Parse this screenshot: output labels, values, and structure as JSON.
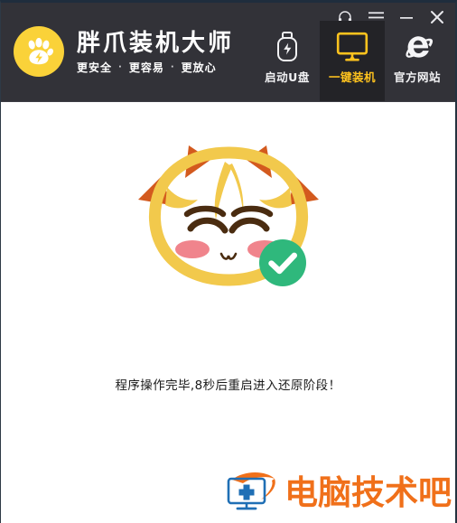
{
  "window": {
    "controls": [
      {
        "name": "support-headset",
        "label": "客服"
      },
      {
        "name": "menu",
        "label": "菜单"
      },
      {
        "name": "minimize",
        "label": "最小化"
      },
      {
        "name": "close",
        "label": "关闭"
      }
    ]
  },
  "brand": {
    "logo_icon": "paw-lightning-icon",
    "title": "胖爪装机大师",
    "subtitle_parts": [
      "更安全",
      "更容易",
      "更放心"
    ],
    "separator": "·"
  },
  "nav": {
    "items": [
      {
        "icon": "usb-drive-icon",
        "label": "启动U盘",
        "active": false
      },
      {
        "icon": "monitor-icon",
        "label": "一键装机",
        "active": true
      },
      {
        "icon": "internet-explorer-icon",
        "label": "官方网站",
        "active": false
      }
    ]
  },
  "main": {
    "mascot_icon": "cat-mascot-icon",
    "success_badge_icon": "check-circle-icon",
    "status_text": "程序操作完毕,8秒后重启进入还原阶段！"
  },
  "watermark": {
    "icon": "monitor-medical-cross-icon",
    "text": "电脑技术吧"
  },
  "colors": {
    "header_bg": "#323238",
    "active_tab_bg": "#232327",
    "accent_yellow": "#ffc31e",
    "logo_yellow": "#fad239",
    "mascot_yellow": "#f2c94c",
    "mascot_orange": "#d35a1e",
    "success_green": "#2fb87c",
    "cheek_pink": "#f0848c",
    "watermark_orange": "#f0701a",
    "watermark_blue": "#1f6fb5",
    "body_bg": "#ffffff",
    "status_text": "#1a1a1a"
  }
}
